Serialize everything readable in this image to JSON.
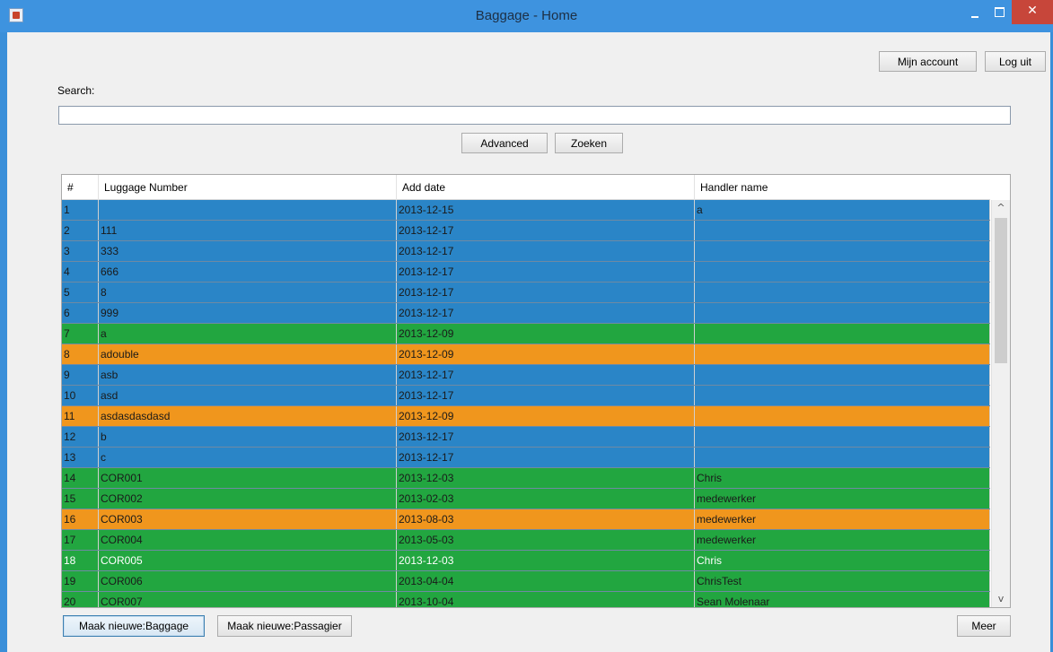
{
  "window": {
    "title": "Baggage - Home",
    "close_glyph": "✕"
  },
  "header": {
    "account_label": "Mijn account",
    "logout_label": "Log uit"
  },
  "search": {
    "label": "Search:",
    "value": "",
    "placeholder": "",
    "advanced_label": "Advanced",
    "search_label": "Zoeken"
  },
  "colors": {
    "blue": "#2a85c7",
    "green": "#22a640",
    "orange": "#f0961d"
  },
  "table": {
    "columns": [
      "#",
      "Luggage Number",
      "Add date",
      "Handler name"
    ],
    "rows": [
      {
        "n": "1",
        "number": "",
        "date": "2013-12-15",
        "handler": "a",
        "status": "blue"
      },
      {
        "n": "2",
        "number": "111",
        "date": "2013-12-17",
        "handler": "",
        "status": "blue"
      },
      {
        "n": "3",
        "number": "333",
        "date": "2013-12-17",
        "handler": "",
        "status": "blue"
      },
      {
        "n": "4",
        "number": "666",
        "date": "2013-12-17",
        "handler": "",
        "status": "blue"
      },
      {
        "n": "5",
        "number": "8",
        "date": "2013-12-17",
        "handler": "",
        "status": "blue"
      },
      {
        "n": "6",
        "number": "999",
        "date": "2013-12-17",
        "handler": "",
        "status": "blue"
      },
      {
        "n": "7",
        "number": "a",
        "date": "2013-12-09",
        "handler": "",
        "status": "green"
      },
      {
        "n": "8",
        "number": "adouble",
        "date": "2013-12-09",
        "handler": "",
        "status": "orange"
      },
      {
        "n": "9",
        "number": "asb",
        "date": "2013-12-17",
        "handler": "",
        "status": "blue"
      },
      {
        "n": "10",
        "number": "asd",
        "date": "2013-12-17",
        "handler": "",
        "status": "blue"
      },
      {
        "n": "11",
        "number": "asdasdasdasd",
        "date": "2013-12-09",
        "handler": "",
        "status": "orange"
      },
      {
        "n": "12",
        "number": "b",
        "date": "2013-12-17",
        "handler": "",
        "status": "blue"
      },
      {
        "n": "13",
        "number": "c",
        "date": "2013-12-17",
        "handler": "",
        "status": "blue"
      },
      {
        "n": "14",
        "number": "COR001",
        "date": "2013-12-03",
        "handler": "Chris",
        "status": "green"
      },
      {
        "n": "15",
        "number": "COR002",
        "date": "2013-02-03",
        "handler": "medewerker",
        "status": "green"
      },
      {
        "n": "16",
        "number": "COR003",
        "date": "2013-08-03",
        "handler": "medewerker",
        "status": "orange"
      },
      {
        "n": "17",
        "number": "COR004",
        "date": "2013-05-03",
        "handler": "medewerker",
        "status": "green"
      },
      {
        "n": "18",
        "number": "COR005",
        "date": "2013-12-03",
        "handler": "Chris",
        "status": "green",
        "white_text": true
      },
      {
        "n": "19",
        "number": "COR006",
        "date": "2013-04-04",
        "handler": "ChrisTest",
        "status": "green"
      },
      {
        "n": "20",
        "number": "COR007",
        "date": "2013-10-04",
        "handler": "Sean Molenaar",
        "status": "green"
      }
    ]
  },
  "scrollbar": {
    "up_glyph": "^",
    "down_glyph": "v"
  },
  "footer": {
    "new_baggage_label": "Maak nieuwe:Baggage",
    "new_passenger_label": "Maak nieuwe:Passagier",
    "more_label": "Meer"
  }
}
